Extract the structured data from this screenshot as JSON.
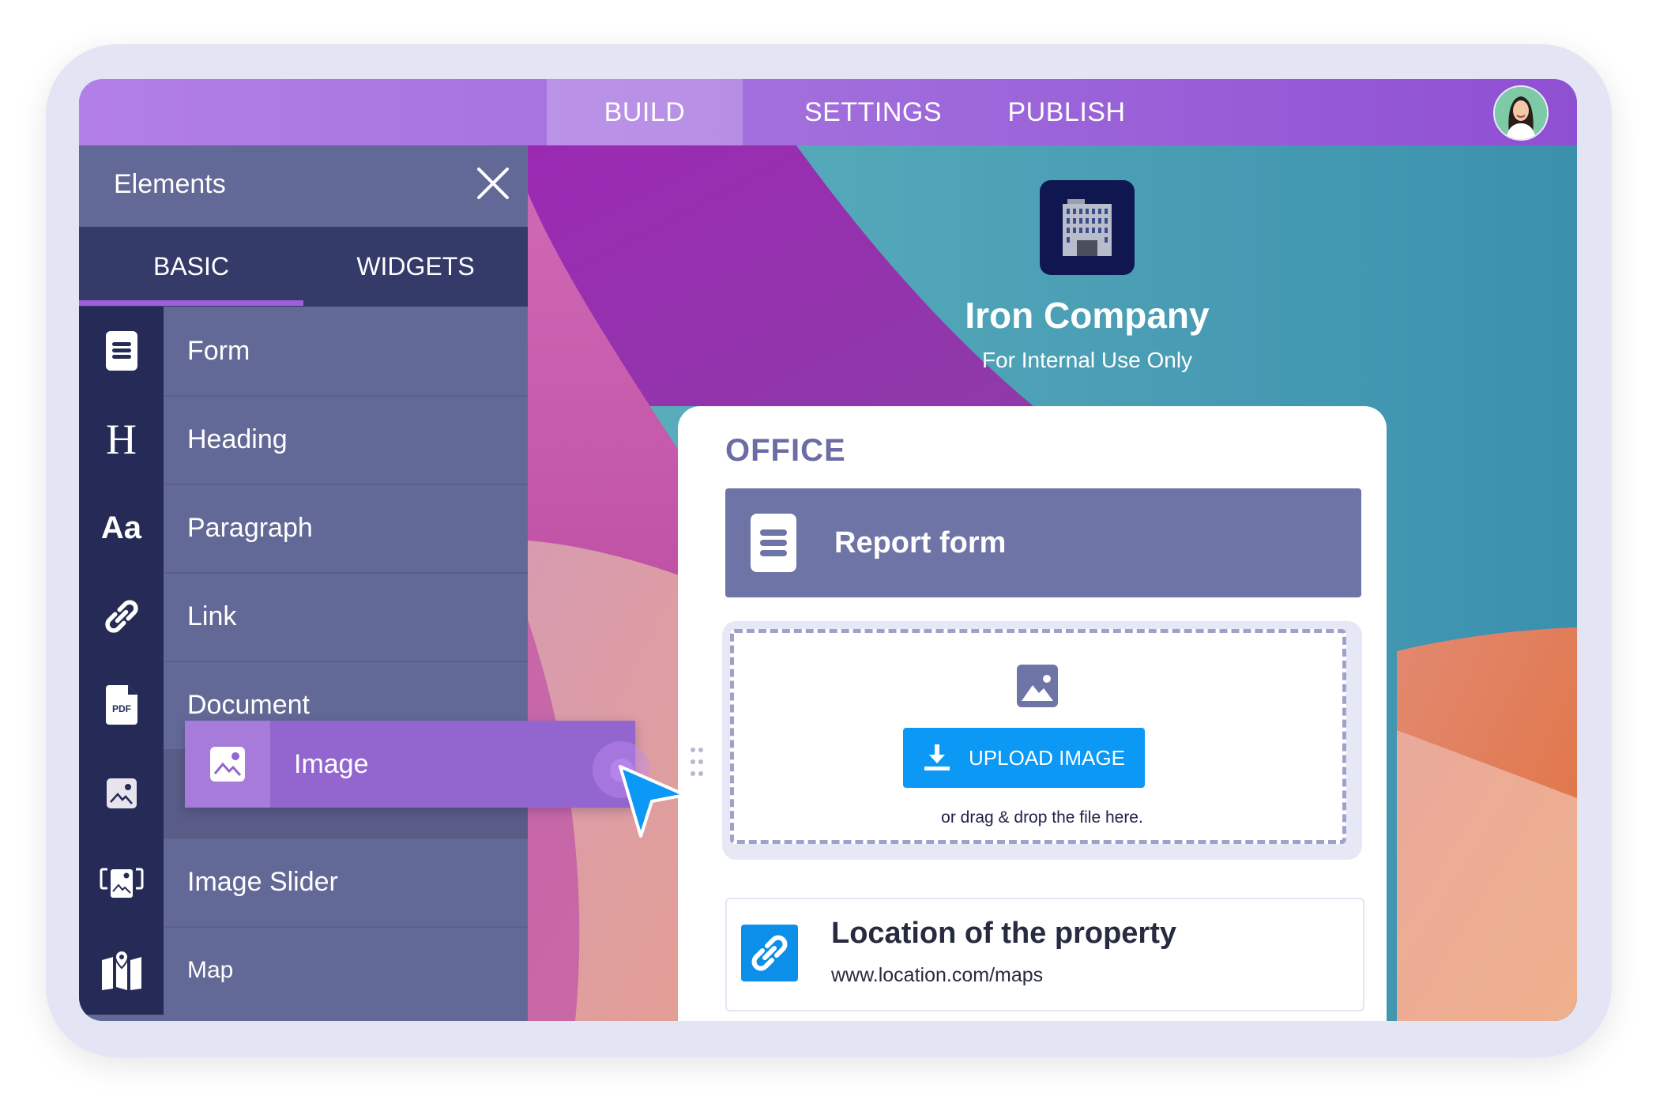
{
  "nav": {
    "tabs": [
      {
        "label": "BUILD",
        "active": true
      },
      {
        "label": "SETTINGS",
        "active": false
      },
      {
        "label": "PUBLISH",
        "active": false
      }
    ],
    "avatar_icon": "user-avatar"
  },
  "sidebar": {
    "title": "Elements",
    "close_icon": "close-icon",
    "tabs": [
      {
        "label": "BASIC",
        "active": true
      },
      {
        "label": "WIDGETS",
        "active": false
      }
    ],
    "items": [
      {
        "label": "Form",
        "icon": "form-icon"
      },
      {
        "label": "Heading",
        "icon": "heading-icon",
        "glyph": "H"
      },
      {
        "label": "Paragraph",
        "icon": "paragraph-icon",
        "glyph": "Aa"
      },
      {
        "label": "Link",
        "icon": "link-icon"
      },
      {
        "label": "Document",
        "icon": "pdf-icon",
        "glyph": "PDF"
      },
      {
        "label": "Image",
        "icon": "image-icon"
      },
      {
        "label": "Image Slider",
        "icon": "image-slider-icon"
      },
      {
        "label": "Map",
        "icon": "map-icon"
      }
    ],
    "dragging": {
      "label": "Image",
      "icon": "image-icon"
    }
  },
  "page": {
    "logo_icon": "office-building-icon",
    "company_name": "Iron Company",
    "tagline": "For Internal Use Only",
    "section_title": "OFFICE",
    "report_form": {
      "label": "Report form",
      "icon": "form-icon"
    },
    "upload": {
      "button_label": "UPLOAD IMAGE",
      "hint": "or drag & drop the file here."
    },
    "link": {
      "title": "Location of the property",
      "url": "www.location.com/maps"
    }
  },
  "colors": {
    "header_start": "#b27fe6",
    "header_end": "#8f4fd2",
    "sidebar": "#636996",
    "sidebar_tabs": "#343b69",
    "tab_underline": "#9f5fd9",
    "upload_button": "#0b99f5",
    "report_form_bg": "#6f74a6"
  }
}
